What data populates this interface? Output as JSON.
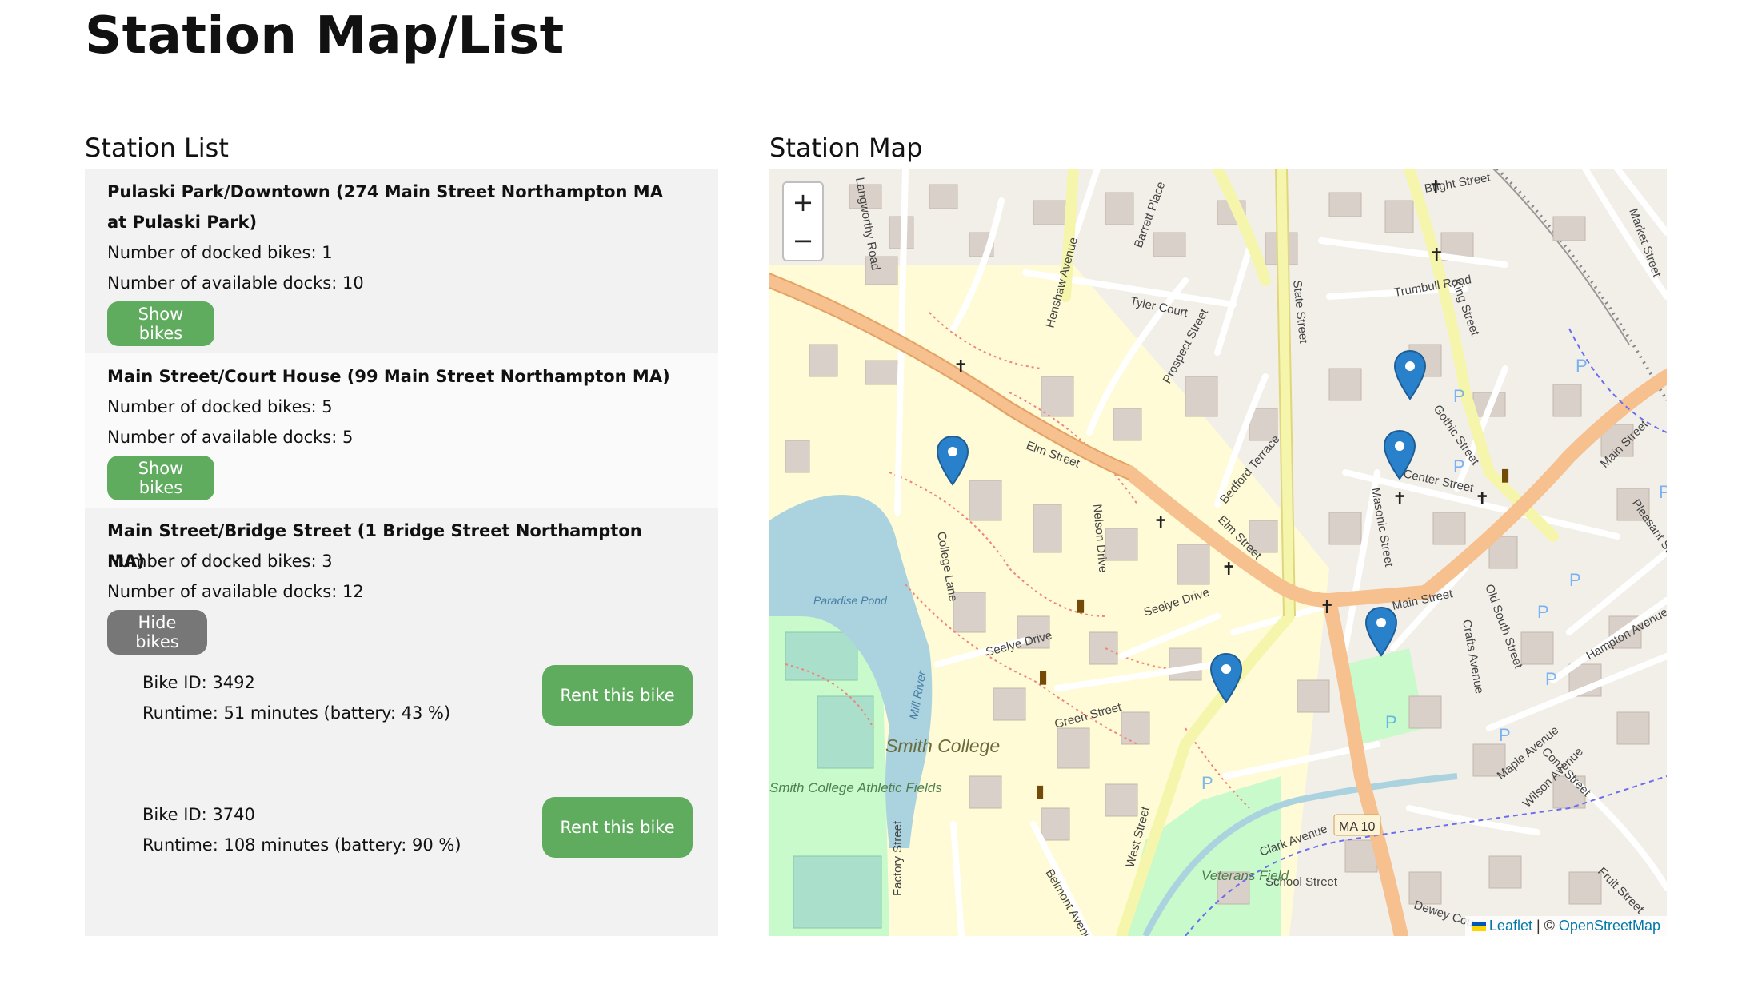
{
  "page": {
    "title": "Station Map/List"
  },
  "list_title": "Station List",
  "map_title": "Station Map",
  "stations": [
    {
      "name": "Pulaski Park/Downtown (274 Main Street Northampton MA at Pulaski Park)",
      "docked": "Number of docked bikes: 1",
      "available": "Number of available docks: 10",
      "toggle_label": "Show bikes"
    },
    {
      "name": "Main Street/Court House (99 Main Street Northampton MA)",
      "docked": "Number of docked bikes: 5",
      "available": "Number of available docks: 5",
      "toggle_label": "Show bikes"
    },
    {
      "name": "Main Street/Bridge Street (1 Bridge Street Northampton MA)",
      "docked": "Number of docked bikes: 3",
      "available": "Number of available docks: 12",
      "toggle_label": "Hide bikes",
      "bikes": [
        {
          "id": "Bike ID: 3492",
          "runtime": "Runtime: 51 minutes (battery: 43 %)",
          "rent_label": "Rent this bike"
        },
        {
          "id": "Bike ID: 3740",
          "runtime": "Runtime: 108 minutes (battery: 90 %)",
          "rent_label": "Rent this bike"
        }
      ]
    }
  ],
  "map": {
    "zoom_in": "+",
    "zoom_out": "−",
    "attribution": {
      "leaflet": "Leaflet",
      "separator": " | © ",
      "osm": "OpenStreetMap"
    },
    "labels": {
      "elm_street": "Elm Street",
      "elm_street_2": "Elm Street",
      "state_street": "State Street",
      "king_street": "King Street",
      "main_street": "Main Street",
      "center_street": "Center Street",
      "smith_college": "Smith College",
      "paradise_pond": "Paradise Pond",
      "mill_river": "Mill River",
      "green_street": "Green Street",
      "seelye_drive": "Seelye Drive",
      "seelye_drive_2": "Seelye Drive",
      "west_street": "West Street",
      "veterans_field": "Veterans Field",
      "ma_10": "MA 10",
      "smith_athletic": "Smith College Athletic Fields",
      "bright_street": "Bright Street",
      "trumbull_road": "Trumbull Road",
      "tyler_court": "Tyler Court",
      "prospect_street": "Prospect Street",
      "henshaw_avenue": "Henshaw Avenue",
      "college_lane": "College Lane",
      "pleasant_street": "Pleasant Street",
      "hampton_avenue": "Hampton Avenue",
      "conz_street": "Conz Street",
      "school_street": "School Street",
      "clark_avenue": "Clark Avenue",
      "bedford_terrace": "Bedford Terrace",
      "masonic_street": "Masonic Street",
      "crafts_avenue": "Crafts Avenue",
      "old_south_street": "Old South Street",
      "factory_street": "Factory Street",
      "belmont_avenue": "Belmont Avenue",
      "maple_avenue": "Maple Avenue",
      "dewey_court": "Dewey Court",
      "langworthy_road": "Langworthy Road",
      "barrett_place": "Barrett Place",
      "gothic_street": "Gothic Street",
      "market_street": "Market Street",
      "nelson_drive": "Nelson Drive",
      "wilson_avenue": "Wilson Avenue",
      "fruit_street": "Fruit Street"
    }
  },
  "colors": {
    "button_green": "#5fac5e",
    "button_gray": "#777777",
    "marker_blue": "#2a81cb",
    "primary_road": "#f6c08f",
    "secondary_road": "#f5f5ac",
    "water": "#aad3df",
    "park": "#c8facc",
    "campus": "#fefbd6",
    "building": "#d9d0c9"
  }
}
